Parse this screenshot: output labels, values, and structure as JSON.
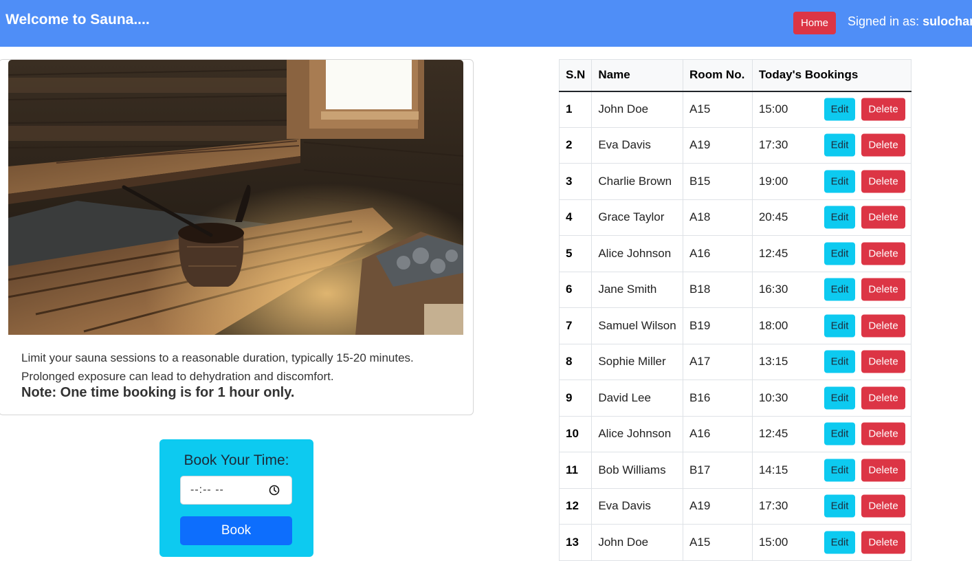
{
  "navbar": {
    "brand": "Welcome to Sauna....",
    "home_label": "Home",
    "signed_prefix": "Signed in as: ",
    "username": "sulochan"
  },
  "card": {
    "image_alt": "sauna-interior-photo",
    "text_line1": "Limit your sauna sessions to a reasonable duration, typically 15-20 minutes.",
    "text_line2": "Prolonged exposure can lead to dehydration and discomfort.",
    "note": "Note: One time booking is for 1 hour only."
  },
  "booking_form": {
    "title": "Book Your Time:",
    "time_value": "--:-- --",
    "book_label": "Book"
  },
  "table": {
    "headers": [
      "S.N",
      "Name",
      "Room No.",
      "Today's Bookings"
    ],
    "edit_label": "Edit",
    "delete_label": "Delete",
    "rows": [
      {
        "sn": "1",
        "name": "John Doe",
        "room": "A15",
        "time": "15:00"
      },
      {
        "sn": "2",
        "name": "Eva Davis",
        "room": "A19",
        "time": "17:30"
      },
      {
        "sn": "3",
        "name": "Charlie Brown",
        "room": "B15",
        "time": "19:00"
      },
      {
        "sn": "4",
        "name": "Grace Taylor",
        "room": "A18",
        "time": "20:45"
      },
      {
        "sn": "5",
        "name": "Alice Johnson",
        "room": "A16",
        "time": "12:45"
      },
      {
        "sn": "6",
        "name": "Jane Smith",
        "room": "B18",
        "time": "16:30"
      },
      {
        "sn": "7",
        "name": "Samuel Wilson",
        "room": "B19",
        "time": "18:00"
      },
      {
        "sn": "8",
        "name": "Sophie Miller",
        "room": "A17",
        "time": "13:15"
      },
      {
        "sn": "9",
        "name": "David Lee",
        "room": "B16",
        "time": "10:30"
      },
      {
        "sn": "10",
        "name": "Alice Johnson",
        "room": "A16",
        "time": "12:45"
      },
      {
        "sn": "11",
        "name": "Bob Williams",
        "room": "B17",
        "time": "14:15"
      },
      {
        "sn": "12",
        "name": "Eva Davis",
        "room": "A19",
        "time": "17:30"
      },
      {
        "sn": "13",
        "name": "John Doe",
        "room": "A15",
        "time": "15:00"
      }
    ]
  },
  "colors": {
    "navbar": "#4f8ef7",
    "danger": "#dc3545",
    "info": "#0dcaf0",
    "primary": "#0d6efd"
  }
}
